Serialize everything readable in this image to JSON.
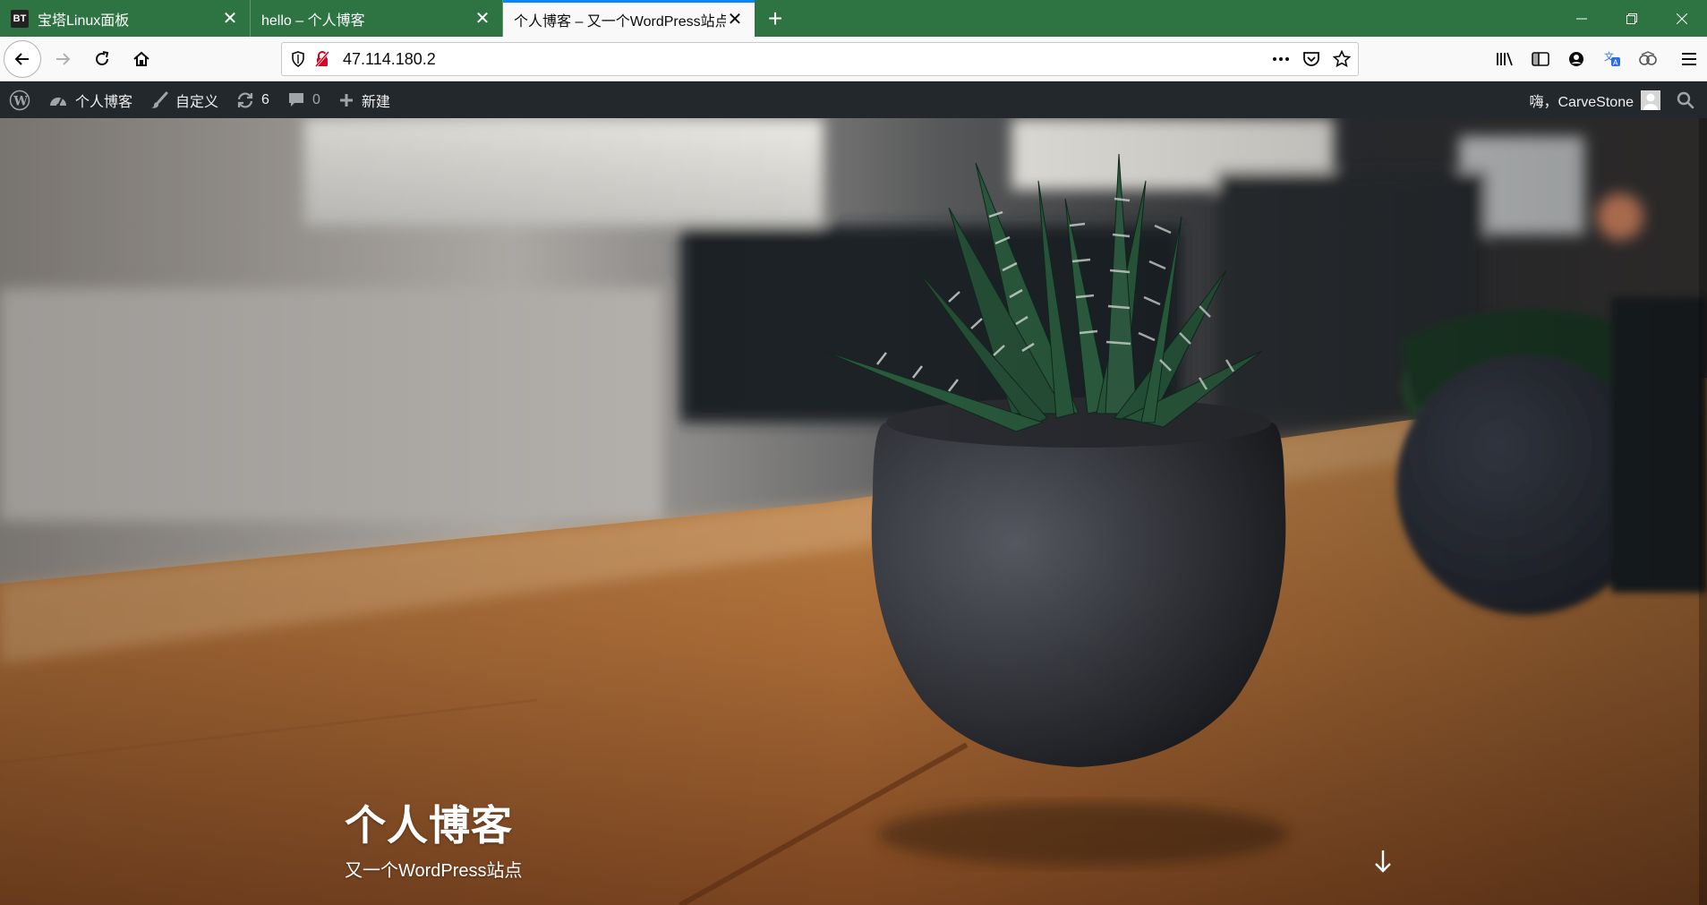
{
  "tabs": [
    {
      "label": "宝塔Linux面板",
      "favicon_text": "BT"
    },
    {
      "label": "hello – 个人博客"
    },
    {
      "label": "个人博客 – 又一个WordPress站点",
      "active": true
    }
  ],
  "nav": {
    "url": "47.114.180.2"
  },
  "adminbar": {
    "site_name": "个人博客",
    "customize": "自定义",
    "updates_count": "6",
    "comments_count": "0",
    "new_label": "新建",
    "greeting": "嗨，CarveStone"
  },
  "hero": {
    "site_title": "个人博客",
    "site_description": "又一个WordPress站点"
  },
  "colors": {
    "tab_strip": "#2e7443",
    "admin_bar": "#23282d",
    "active_tab_accent": "#0a84ff"
  },
  "icons": [
    "back-arrow-icon",
    "forward-arrow-icon",
    "reload-icon",
    "home-icon",
    "shield-icon",
    "insecure-lock-icon",
    "more-icon",
    "pocket-icon",
    "star-icon",
    "library-icon",
    "sidebar-icon",
    "account-icon",
    "translate-icon",
    "extension-icon",
    "menu-icon",
    "wordpress-logo-icon",
    "dashboard-icon",
    "brush-icon",
    "updates-icon",
    "comment-icon",
    "plus-icon",
    "search-icon",
    "arrow-down-icon"
  ]
}
